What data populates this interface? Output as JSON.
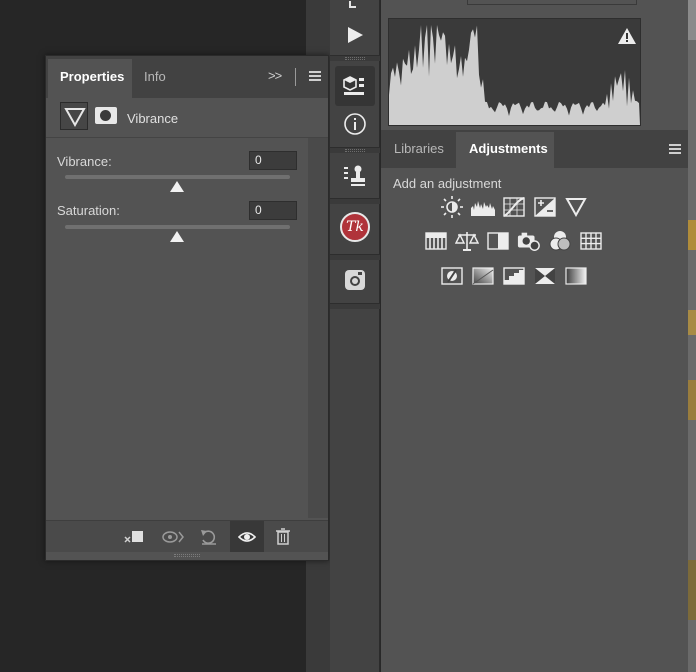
{
  "properties_panel": {
    "tabs": [
      {
        "label": "Properties",
        "active": true
      },
      {
        "label": "Info",
        "active": false
      }
    ],
    "collapse_label": ">>",
    "layer_name": "Vibrance",
    "controls": [
      {
        "label": "Vibrance:",
        "value": "0"
      },
      {
        "label": "Saturation:",
        "value": "0"
      }
    ],
    "footer_icons": [
      "clip-to-layer-icon",
      "view-previous-state-icon",
      "reset-icon",
      "visibility-eye-icon",
      "trash-icon"
    ]
  },
  "tool_strip": {
    "icons": [
      "play-icon",
      "3d-icon",
      "info-icon",
      "clone-source-icon",
      "tk-plugin-icon",
      "instagram-icon"
    ],
    "tk_label": "Tk"
  },
  "adjustments_panel": {
    "tabs": [
      {
        "label": "Libraries",
        "active": false
      },
      {
        "label": "Adjustments",
        "active": true
      }
    ],
    "title": "Add an adjustment",
    "rows": [
      [
        "brightness-contrast-icon",
        "levels-icon",
        "curves-icon",
        "exposure-icon",
        "vibrance-icon"
      ],
      [
        "hue-saturation-icon",
        "color-balance-icon",
        "black-white-icon",
        "photo-filter-icon",
        "channel-mixer-icon",
        "color-lookup-icon"
      ],
      [
        "invert-icon",
        "posterize-icon",
        "threshold-icon",
        "selective-color-icon",
        "gradient-map-icon"
      ]
    ]
  },
  "histogram": {
    "warning_icon": "warning-icon"
  }
}
